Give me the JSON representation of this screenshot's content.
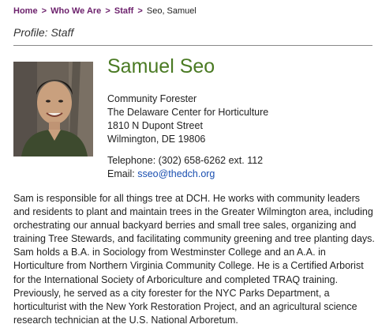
{
  "breadcrumb": {
    "items": [
      "Home",
      "Who We Are",
      "Staff"
    ],
    "separator": ">",
    "current": "Seo, Samuel"
  },
  "page": {
    "section_title": "Profile: Staff"
  },
  "profile": {
    "name": "Samuel Seo",
    "title": "Community Forester",
    "organization": "The Delaware Center for Horticulture",
    "street": "1810 N Dupont Street",
    "city_state_zip": "Wilmington, DE 19806",
    "telephone": "Telephone: (302) 658-6262 ext. 112",
    "email_label": "Email:",
    "email": "sseo@thedch.org",
    "photo_icon": "staff-photo"
  },
  "bio": "Sam is responsible for all things tree at DCH. He works with community leaders and residents to plant and maintain trees in the Greater Wilmington area, including orchestrating our annual backyard berries and small tree sales, organizing and training Tree Stewards, and facilitating community greening and tree planting days. Sam holds a B.A. in Sociology from Westminster College and an A.A. in Horticulture from Northern Virginia Community College. He is a Certified Arborist for the International Society of Arboriculture and completed TRAQ training. Previously, he served as a city forester for the NYC Parks Department, a horticulturist with the New York Restoration Project, and an agricultural science research technician at the U.S. National Arboretum.",
  "colors": {
    "breadcrumb_link": "#6b1f6b",
    "name": "#4a7a23",
    "email_link": "#1a4fb0",
    "divider": "#8a8a8a"
  }
}
